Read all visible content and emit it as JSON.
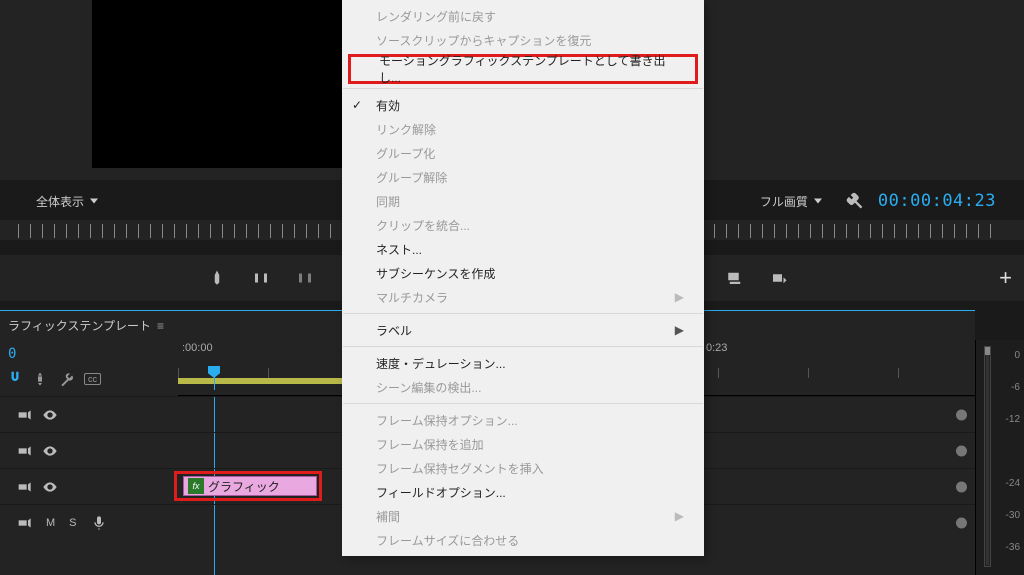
{
  "monitor": {
    "view_mode": "全体表示",
    "quality": "フル画質",
    "timecode": "00:00:04:23"
  },
  "panel": {
    "title": "ラフィックステンプレート"
  },
  "timeline": {
    "current_tc_suffix": "0",
    "ruler_labels": [
      ":00:00",
      "0:23"
    ],
    "clip_label": "グラフィック",
    "audio_labels": {
      "mute": "M",
      "solo": "S"
    }
  },
  "db_ruler": [
    "0",
    "-6",
    "-12",
    " ",
    "-24",
    "-30",
    "-36"
  ],
  "context_menu": {
    "items_top": [
      {
        "label": "レンダリング前に戻す",
        "disabled": true
      },
      {
        "label": "ソースクリップからキャプションを復元",
        "disabled": true
      }
    ],
    "highlighted": "モーショングラフィックステンプレートとして書き出し...",
    "group1": [
      {
        "label": "有効",
        "checked": true
      },
      {
        "label": "リンク解除",
        "disabled": true
      },
      {
        "label": "グループ化",
        "disabled": true
      },
      {
        "label": "グループ解除",
        "disabled": true
      },
      {
        "label": "同期",
        "disabled": true
      },
      {
        "label": "クリップを統合...",
        "disabled": true
      },
      {
        "label": "ネスト..."
      },
      {
        "label": "サブシーケンスを作成"
      },
      {
        "label": "マルチカメラ",
        "disabled": true,
        "submenu": true
      }
    ],
    "group2": [
      {
        "label": "ラベル",
        "submenu": true
      }
    ],
    "group3": [
      {
        "label": "速度・デュレーション..."
      },
      {
        "label": "シーン編集の検出...",
        "disabled": true
      }
    ],
    "group4": [
      {
        "label": "フレーム保持オプション...",
        "disabled": true
      },
      {
        "label": "フレーム保持を追加",
        "disabled": true
      },
      {
        "label": "フレーム保持セグメントを挿入",
        "disabled": true
      },
      {
        "label": "フィールドオプション..."
      },
      {
        "label": "補間",
        "disabled": true,
        "submenu": true
      },
      {
        "label": "フレームサイズに合わせる",
        "disabled": true
      }
    ]
  }
}
